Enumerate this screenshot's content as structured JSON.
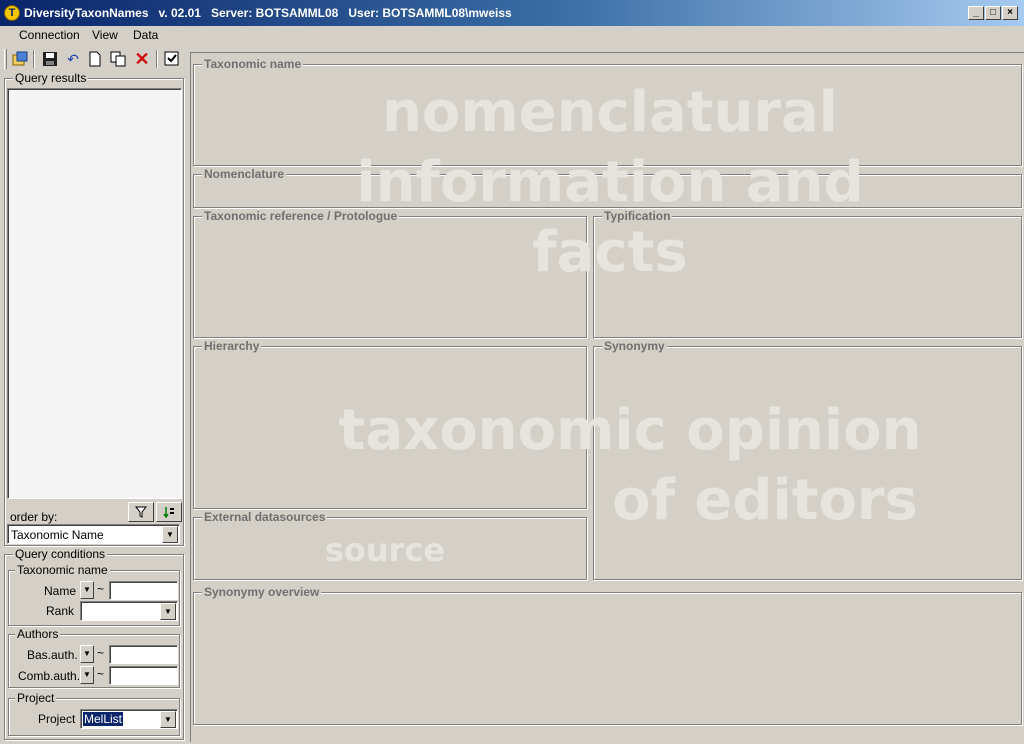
{
  "window": {
    "title": "DiversityTaxonNames   v. 02.01   Server: BOTSAMML08   User: BOTSAMML08\\mweiss",
    "icon_letter": "T",
    "controls": [
      "minimize-icon",
      "maximize-icon",
      "close-icon"
    ]
  },
  "menu": {
    "items": [
      "Connection",
      "View",
      "Data"
    ]
  },
  "toolbar": {
    "icons": [
      "open-database-icon",
      "save-icon",
      "undo-icon",
      "new-document-icon",
      "copy-icon",
      "delete-icon",
      "checkbox-icon"
    ]
  },
  "query_results": {
    "title": "Query results",
    "order_by_label": "order by:",
    "order_by_value": "Taxonomic Name",
    "filter_icon": "filter-icon",
    "sort_icon": "sort-icon"
  },
  "query_conditions": {
    "title": "Query conditions",
    "taxonomic_name": {
      "title": "Taxonomic name",
      "name_label": "Name",
      "name_operator": "~",
      "name_value": "",
      "rank_label": "Rank",
      "rank_value": ""
    },
    "authors": {
      "title": "Authors",
      "bas_label": "Bas.auth.",
      "bas_operator": "~",
      "bas_value": "",
      "comb_label": "Comb.auth.",
      "comb_operator": "~",
      "comb_value": ""
    },
    "project": {
      "title": "Project",
      "project_label": "Project",
      "project_value": "MelList"
    }
  },
  "sections": {
    "taxonomic_name": "Taxonomic name",
    "nomenclature": "Nomenclature",
    "taxonomic_reference": "Taxonomic reference / Protologue",
    "typification": "Typification",
    "hierarchy": "Hierarchy",
    "synonymy": "Synonymy",
    "external_datasources": "External datasources",
    "synonymy_overview": "Synonymy overview"
  },
  "watermarks": {
    "nomenclatural_1": "nomenclatural",
    "nomenclatural_2": "information and",
    "nomenclatural_3": "facts",
    "opinion_1": "taxonomic opinion",
    "opinion_2": "of editors",
    "source": "source"
  }
}
